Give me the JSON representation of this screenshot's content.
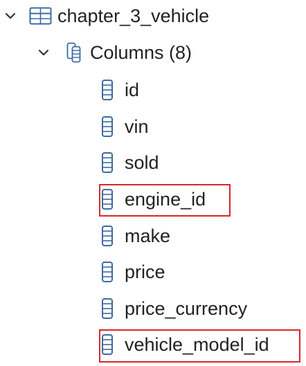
{
  "tree": {
    "table": {
      "label": "chapter_3_vehicle",
      "icon": "table-icon",
      "expanded": true
    },
    "columns_node": {
      "label": "Columns (8)",
      "icon": "columns-icon",
      "expanded": true
    },
    "columns": [
      {
        "label": "id",
        "highlighted": false
      },
      {
        "label": "vin",
        "highlighted": false
      },
      {
        "label": "sold",
        "highlighted": false
      },
      {
        "label": "engine_id",
        "highlighted": true
      },
      {
        "label": "make",
        "highlighted": false
      },
      {
        "label": "price",
        "highlighted": false
      },
      {
        "label": "price_currency",
        "highlighted": false
      },
      {
        "label": "vehicle_model_id",
        "highlighted": true
      }
    ]
  },
  "colors": {
    "icon_stroke": "#3d6aa0",
    "icon_fill": "#ffffff",
    "chevron": "#333333",
    "highlight_border": "#d9262a",
    "text": "#222222"
  }
}
